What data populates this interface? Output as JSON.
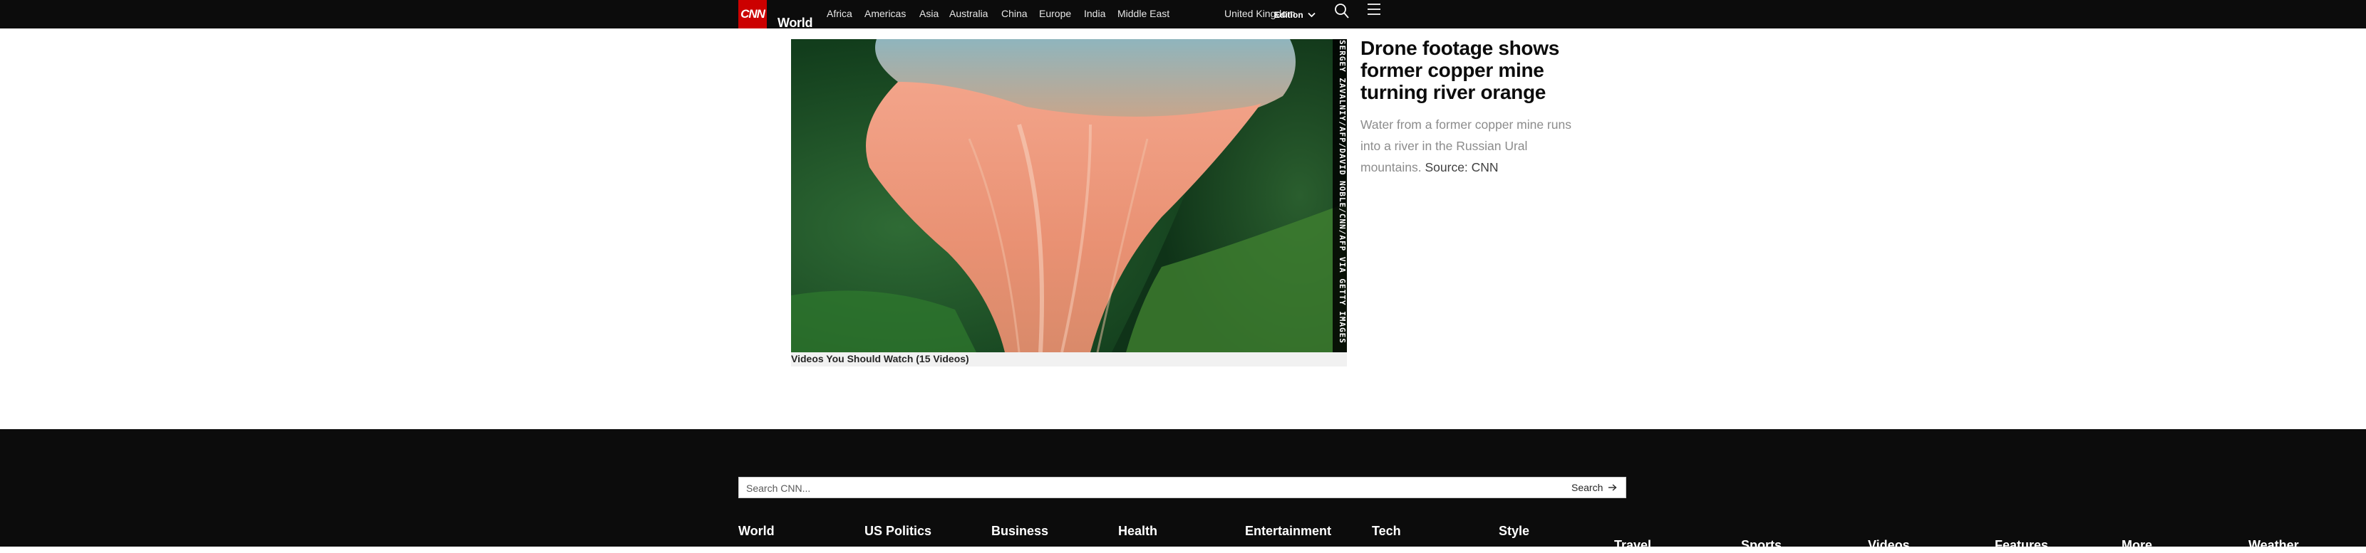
{
  "header": {
    "logo": "CNN",
    "section": "World",
    "nav": [
      "Africa",
      "Americas",
      "Asia",
      "Australia",
      "China",
      "Europe",
      "India",
      "Middle East",
      "United Kingdom"
    ],
    "edition_label": "Edition",
    "icons": {
      "search": "search-icon",
      "menu": "hamburger-menu-icon",
      "edition": "chevron-down-icon"
    }
  },
  "video": {
    "credit": "SERGEY ZAVALNIY/AFP/DAVID NOBLE/CNN/AFP VIA GETTY IMAGES",
    "playlist_label": "Videos You Should Watch (15 Videos)"
  },
  "article": {
    "headline": "Drone footage shows former copper mine turning river orange",
    "summary": "Water from a former copper mine runs into a river in the Russian Ural mountains.",
    "source": "Source: CNN"
  },
  "footer": {
    "search_placeholder": "Search CNN...",
    "search_button": "Search",
    "links_row1": [
      "World",
      "US Politics",
      "Business",
      "Health",
      "Entertainment",
      "Tech",
      "Style"
    ],
    "links_row2": [
      "Travel",
      "Sports",
      "Videos",
      "Features",
      "More",
      "Weather"
    ]
  },
  "colors": {
    "brand_red": "#cc0000",
    "nav_background": "#0c0c0c",
    "footer_background": "#0c0c0c"
  }
}
